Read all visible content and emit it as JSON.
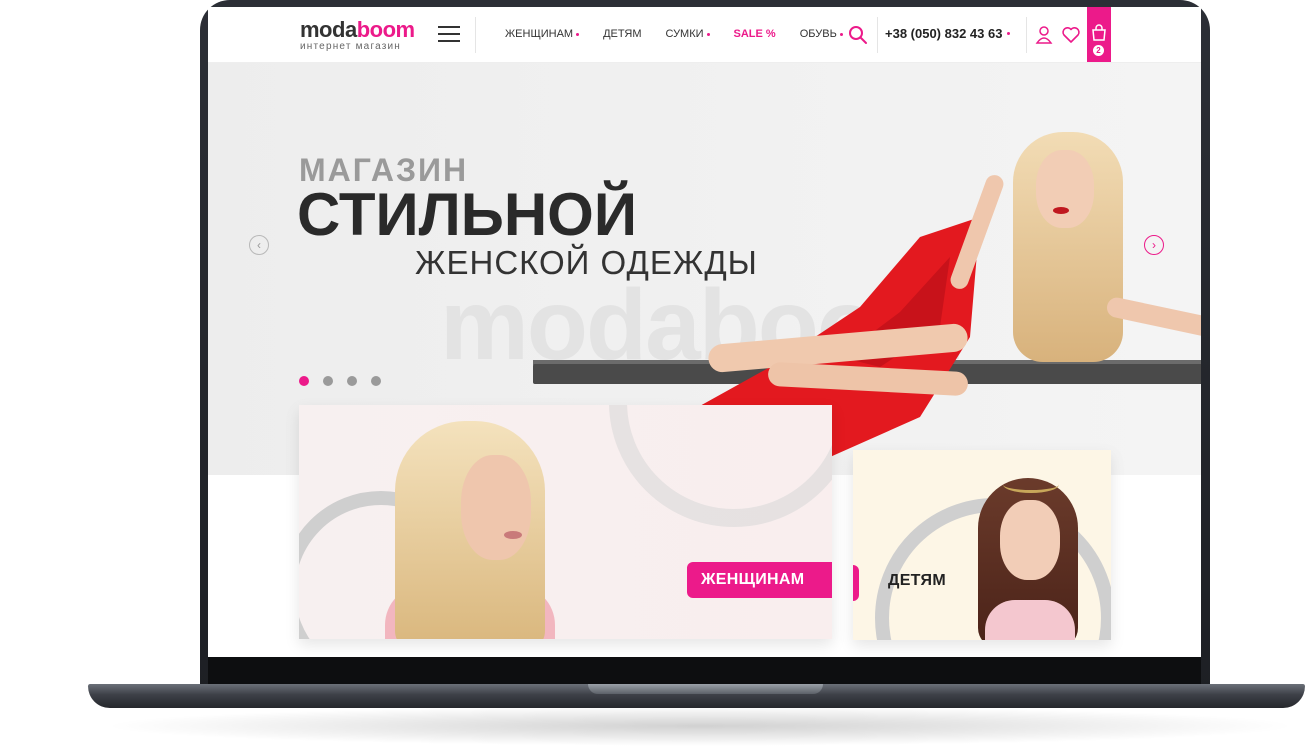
{
  "header": {
    "logo_part1": "moda",
    "logo_part2": "boom",
    "logo_sub": "интернет магазин",
    "nav": [
      {
        "label": "ЖЕНЩИНАМ"
      },
      {
        "label": "ДЕТЯМ"
      },
      {
        "label": "СУМКИ"
      },
      {
        "label": "SALE %"
      },
      {
        "label": "ОБУВЬ"
      }
    ],
    "phone": "+38 (050) 832 43 63",
    "cart_count": "2",
    "icons": [
      "menu-icon",
      "search-icon",
      "user-icon",
      "heart-icon",
      "cart-icon"
    ]
  },
  "hero": {
    "line1": "МАГАЗИН",
    "line2": "СТИЛЬНОЙ",
    "line3": "ЖЕНСКОЙ ОДЕЖДЫ",
    "watermark": "modaboom",
    "slides_total": 4,
    "active_slide": 1,
    "prev_glyph": "‹",
    "next_glyph": "›"
  },
  "categories": {
    "women_label": "ЖЕНЩИНАМ",
    "kids_label": "ДЕТЯМ"
  },
  "colors": {
    "accent": "#ec1a8a",
    "dark": "#2a2a2a",
    "hero_bg": "#efefef",
    "dress": "#e3191f"
  }
}
